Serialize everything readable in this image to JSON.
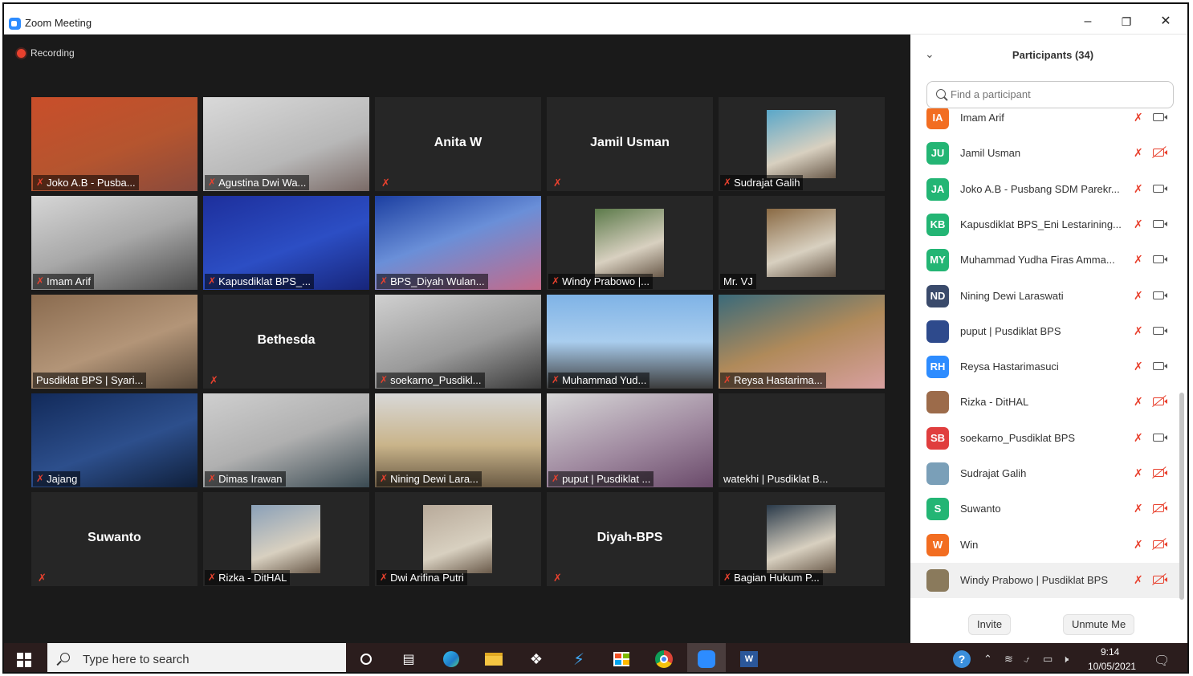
{
  "window": {
    "title": "Zoom Meeting",
    "minimize": "–",
    "restore": "❐",
    "close": "✕"
  },
  "meeting": {
    "recording_label": "Recording",
    "tiles": [
      {
        "name": "Joko A.B - Pusba...",
        "mic_muted": true
      },
      {
        "name": "Agustina Dwi Wa...",
        "mic_muted": true
      },
      {
        "name": "Anita W",
        "mic_muted": true,
        "video": false
      },
      {
        "name": "Jamil Usman",
        "mic_muted": true,
        "video": false
      },
      {
        "name": "Sudrajat Galih",
        "mic_muted": true
      },
      {
        "name": "Imam Arif",
        "mic_muted": true
      },
      {
        "name": "Kapusdiklat BPS_...",
        "mic_muted": true,
        "active_speaker": true
      },
      {
        "name": "BPS_Diyah Wulan...",
        "mic_muted": true
      },
      {
        "name": "Windy Prabowo |...",
        "mic_muted": true
      },
      {
        "name": "Mr. VJ",
        "mic_muted": false
      },
      {
        "name": "Pusdiklat BPS | Syari...",
        "mic_muted": false
      },
      {
        "name": "Bethesda",
        "mic_muted": true,
        "video": false
      },
      {
        "name": "soekarno_Pusdikl...",
        "mic_muted": true
      },
      {
        "name": "Muhammad Yud...",
        "mic_muted": true
      },
      {
        "name": "Reysa Hastarima...",
        "mic_muted": true
      },
      {
        "name": "Jajang",
        "mic_muted": true
      },
      {
        "name": "Dimas Irawan",
        "mic_muted": true
      },
      {
        "name": "Nining Dewi Lara...",
        "mic_muted": true
      },
      {
        "name": "puput | Pusdiklat ...",
        "mic_muted": true
      },
      {
        "name": "watekhi | Pusdiklat B...",
        "mic_muted": false,
        "video": false
      },
      {
        "name": "Suwanto",
        "mic_muted": true,
        "video": false
      },
      {
        "name": "Rizka - DitHAL",
        "mic_muted": true
      },
      {
        "name": "Dwi Arifina Putri",
        "mic_muted": true
      },
      {
        "name": "Diyah-BPS",
        "mic_muted": true,
        "video": false
      },
      {
        "name": "Bagian Hukum P...",
        "mic_muted": true
      }
    ]
  },
  "participants_panel": {
    "title": "Participants (34)",
    "search": {
      "placeholder": "Find a participant"
    },
    "participants": [
      {
        "initials": "IA",
        "name": "Imam Arif",
        "color": "#f26d21",
        "camera_off": false
      },
      {
        "initials": "JU",
        "name": "Jamil Usman",
        "color": "#23b574",
        "camera_off": true
      },
      {
        "initials": "JA",
        "name": "Joko A.B - Pusbang SDM Parekr...",
        "color": "#23b574",
        "camera_off": false
      },
      {
        "initials": "KB",
        "name": "Kapusdiklat BPS_Eni Lestarining...",
        "color": "#23b574",
        "camera_off": false
      },
      {
        "initials": "MY",
        "name": "Muhammad Yudha Firas Amma...",
        "color": "#23b574",
        "camera_off": false
      },
      {
        "initials": "ND",
        "name": "Nining Dewi Laraswati",
        "color": "#3a4a6b",
        "camera_off": false
      },
      {
        "initials": "",
        "name": "puput | Pusdiklat BPS",
        "color": "#2e4a8c",
        "camera_off": false
      },
      {
        "initials": "RH",
        "name": "Reysa Hastarimasuci",
        "color": "#2d8cff",
        "camera_off": false
      },
      {
        "initials": "",
        "name": "Rizka - DitHAL",
        "color": "#9c6b4a",
        "camera_off": true
      },
      {
        "initials": "SB",
        "name": "soekarno_Pusdiklat BPS",
        "color": "#e03e3e",
        "camera_off": false
      },
      {
        "initials": "",
        "name": "Sudrajat Galih",
        "color": "#7a9fb8",
        "camera_off": true
      },
      {
        "initials": "S",
        "name": "Suwanto",
        "color": "#23b574",
        "camera_off": true
      },
      {
        "initials": "W",
        "name": "Win",
        "color": "#f26d21",
        "camera_off": true
      },
      {
        "initials": "",
        "name": "Windy Prabowo | Pusdiklat BPS",
        "color": "#8a7a5c",
        "camera_off": true
      }
    ],
    "invite_label": "Invite",
    "unmute_label": "Unmute Me"
  },
  "taskbar": {
    "search_placeholder": "Type here to search",
    "time": "9:14",
    "date": "10/05/2021"
  }
}
